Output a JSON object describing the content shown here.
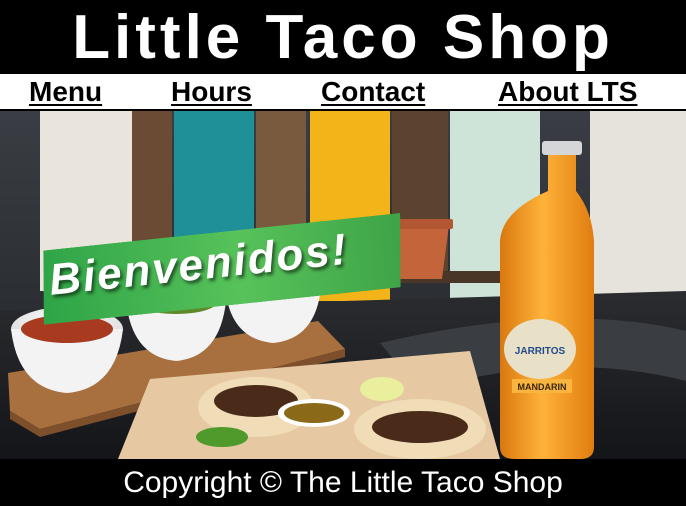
{
  "site": {
    "title": "Little Taco Shop"
  },
  "nav": {
    "items": [
      {
        "label": "Menu"
      },
      {
        "label": "Hours"
      },
      {
        "label": "Contact"
      },
      {
        "label": "About LTS"
      }
    ]
  },
  "hero": {
    "banner_text": "Bienvenidos!",
    "bottle_brand": "JARRITOS",
    "bottle_flavor": "MANDARIN"
  },
  "footer": {
    "copyright": "Copyright © The Little Taco Shop"
  },
  "colors": {
    "header_bg": "#000000",
    "header_text": "#ffffff",
    "banner_green": "#3cae4c",
    "soda_orange": "#f6a020"
  }
}
